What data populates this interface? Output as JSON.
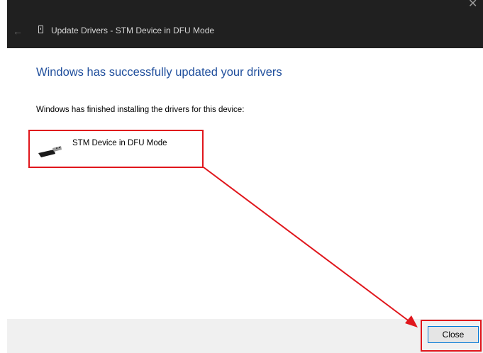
{
  "window": {
    "title": "Update Drivers - STM Device in DFU Mode",
    "back_icon": "back-arrow-icon",
    "close_icon": "close-icon"
  },
  "content": {
    "heading": "Windows has successfully updated your drivers",
    "info": "Windows has finished installing the drivers for this device:",
    "device_name": "STM Device in DFU Mode",
    "device_icon": "usb-connector-icon"
  },
  "footer": {
    "close_label": "Close"
  },
  "annotations": {
    "highlight_color": "#e0161c",
    "heading_color": "#1f4e9c",
    "accent_border": "#0078d7"
  }
}
